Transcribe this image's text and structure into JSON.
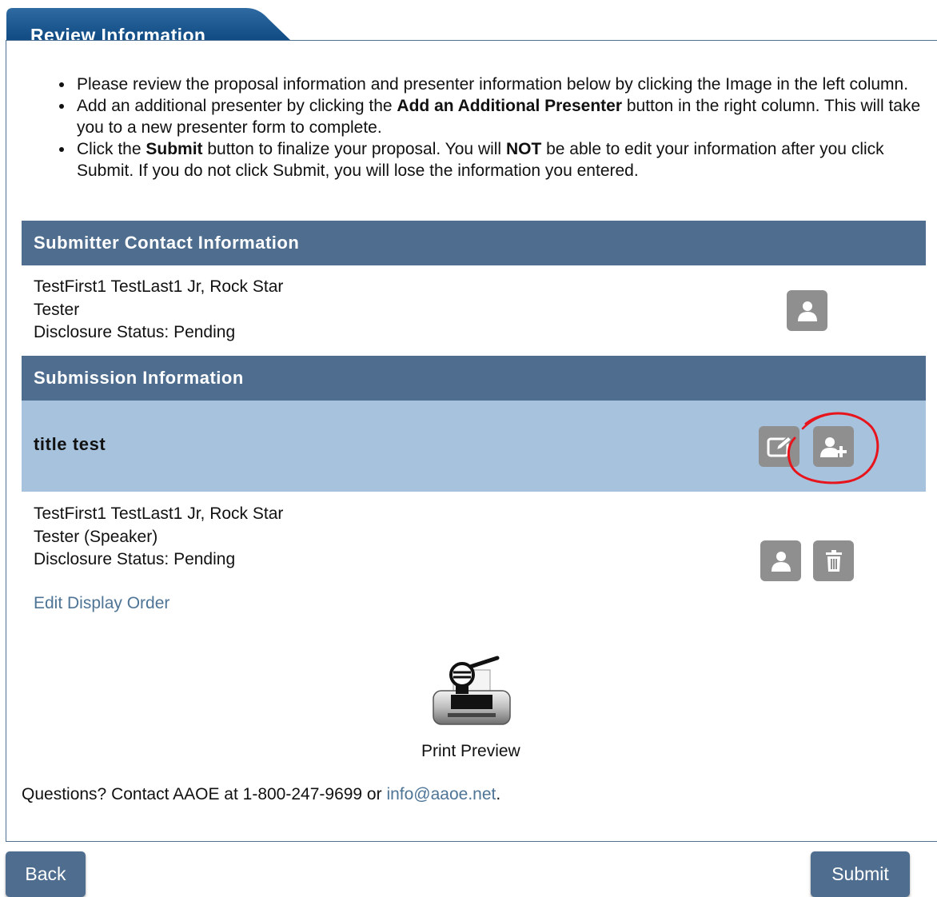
{
  "tab": {
    "title": "Review Information"
  },
  "instructions": [
    {
      "pre": "Please review the proposal information and presenter information below by clicking the Image in the left column."
    },
    {
      "pre": "Add an additional presenter by clicking the ",
      "bold": "Add an Additional Presenter",
      "post": " button in the right column. This will take you to a new presenter form to complete."
    },
    {
      "pre": "Click the ",
      "bold": "Submit",
      "mid": " button to finalize your proposal. You will ",
      "bold2": "NOT",
      "post": " be able to edit your information after you click Submit. If you do not click Submit, you will lose the information you entered."
    }
  ],
  "submitter": {
    "header": "Submitter Contact Information",
    "name": "TestFirst1 TestLast1 Jr, Rock Star",
    "role": "Tester",
    "disclosure": "Disclosure Status: Pending",
    "icon": "user-icon"
  },
  "submission": {
    "header": "Submission Information",
    "title": "title test",
    "icons": [
      "edit-icon",
      "add-user-icon"
    ],
    "annotation_color": "#e8141c",
    "presenter": {
      "name": "TestFirst1 TestLast1 Jr, Rock Star",
      "role": "Tester (Speaker)",
      "disclosure": "Disclosure Status: Pending",
      "icons": [
        "user-icon",
        "trash-icon"
      ]
    },
    "edit_order_label": "Edit Display Order"
  },
  "print_preview": {
    "label": "Print Preview",
    "icon": "print-preview-icon"
  },
  "questions": {
    "text": "Questions? Contact AAOE at 1-800-247-9699 or ",
    "email": "info@aaoe.net",
    "suffix": "."
  },
  "buttons": {
    "back": "Back",
    "submit": "Submit"
  },
  "colors": {
    "header": "#4f6e8f",
    "title_row": "#a6c2dd",
    "icon_button": "#8f8f8f",
    "link": "#4e7496"
  }
}
